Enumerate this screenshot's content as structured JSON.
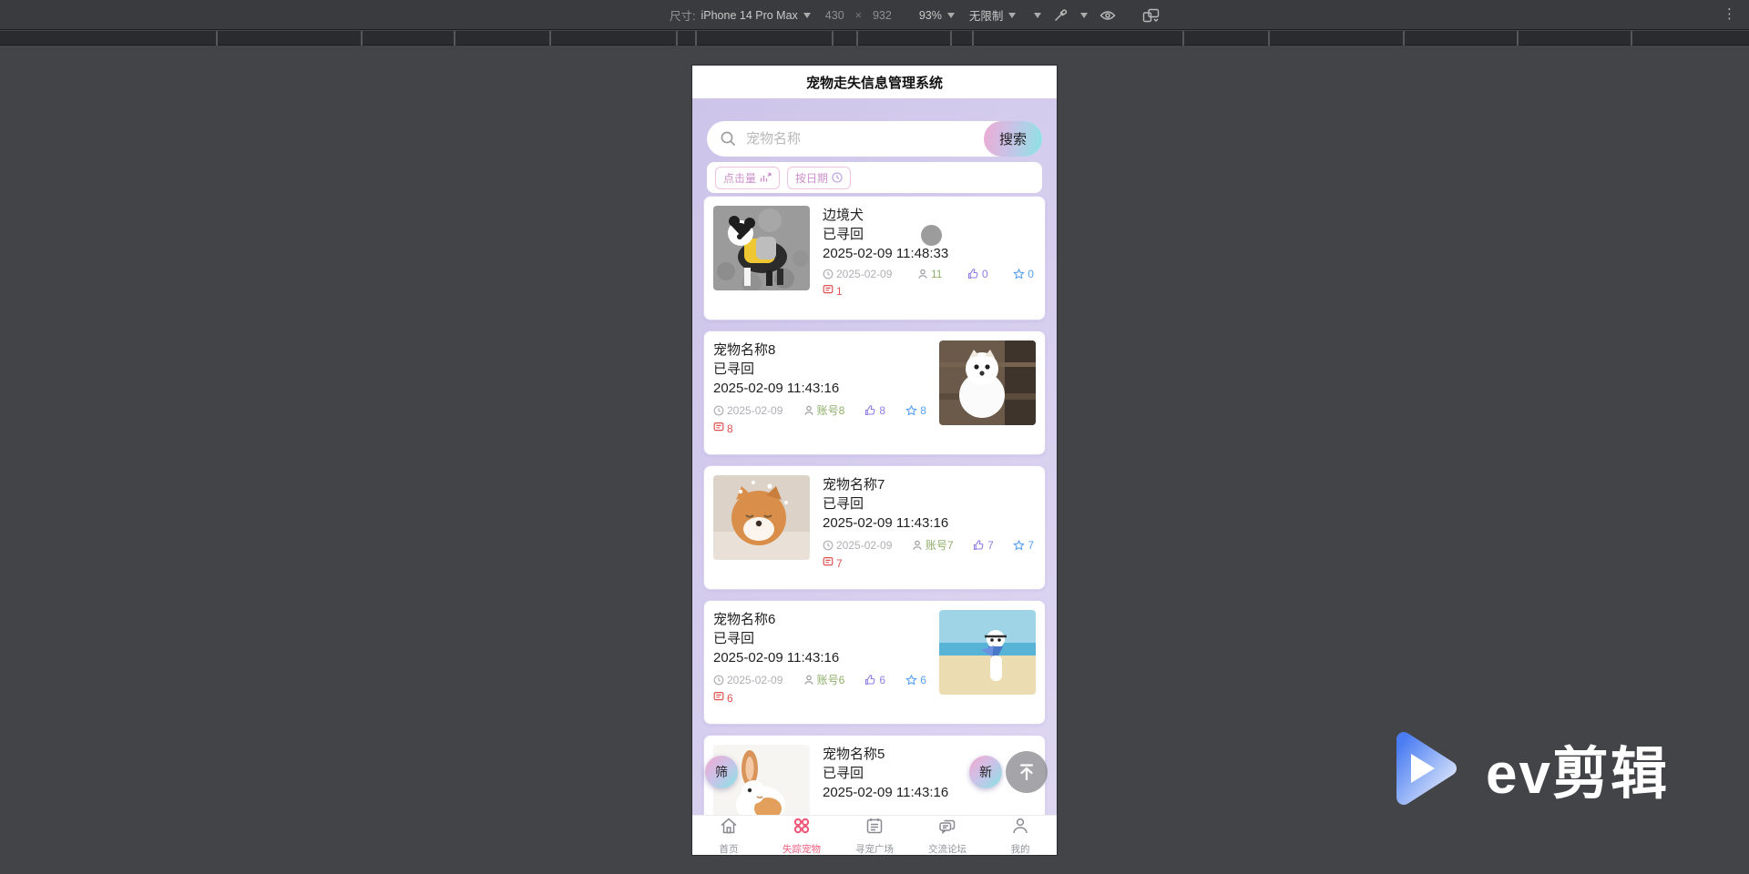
{
  "devtools": {
    "size_label": "尺寸:",
    "device": "iPhone 14 Pro Max",
    "viewport_width": "430",
    "multiply_sign": "×",
    "viewport_height": "932",
    "zoom": "93%",
    "throttling": "无限制",
    "menu_glyph": "⋮"
  },
  "app": {
    "title": "宠物走失信息管理系统",
    "search": {
      "placeholder": "宠物名称",
      "button_label": "搜索"
    },
    "filters": [
      {
        "label": "点击量",
        "icon": "bar-chart-icon"
      },
      {
        "label": "按日期",
        "icon": "clock-icon"
      }
    ],
    "cards": [
      {
        "name": "边境犬",
        "status": "已寻回",
        "datetime": "2025-02-09 11:48:33",
        "image_side": "left",
        "image_alt": "border-collie-dog-photo",
        "has_dot": true,
        "meta": {
          "date": "2025-02-09",
          "user": "11",
          "likes": "0",
          "stars": "0",
          "comments": "1"
        }
      },
      {
        "name": "宠物名称8",
        "status": "已寻回",
        "datetime": "2025-02-09 11:43:16",
        "image_side": "right",
        "image_alt": "white-pomeranian-photo",
        "has_dot": false,
        "meta": {
          "date": "2025-02-09",
          "user": "账号8",
          "likes": "8",
          "stars": "8",
          "comments": "8"
        }
      },
      {
        "name": "宠物名称7",
        "status": "已寻回",
        "datetime": "2025-02-09 11:43:16",
        "image_side": "left",
        "image_alt": "shiba-inu-photo",
        "has_dot": false,
        "meta": {
          "date": "2025-02-09",
          "user": "账号7",
          "likes": "7",
          "stars": "7",
          "comments": "7"
        }
      },
      {
        "name": "宠物名称6",
        "status": "已寻回",
        "datetime": "2025-02-09 11:43:16",
        "image_side": "right",
        "image_alt": "beach-dog-photo",
        "has_dot": false,
        "meta": {
          "date": "2025-02-09",
          "user": "账号6",
          "likes": "6",
          "stars": "6",
          "comments": "6"
        }
      },
      {
        "name": "宠物名称5",
        "status": "已寻回",
        "datetime": "2025-02-09 11:43:16",
        "image_side": "left",
        "image_alt": "rabbit-photo",
        "has_dot": false,
        "meta": null
      }
    ],
    "fabs": {
      "filter_label": "筛",
      "new_label": "新"
    },
    "nav": [
      {
        "label": "首页",
        "icon": "home-icon",
        "active": false
      },
      {
        "label": "失踪宠物",
        "icon": "pets-grid-icon",
        "active": true
      },
      {
        "label": "寻宠广场",
        "icon": "board-icon",
        "active": false
      },
      {
        "label": "交流论坛",
        "icon": "forum-icon",
        "active": false
      },
      {
        "label": "我的",
        "icon": "profile-icon",
        "active": false
      }
    ]
  },
  "watermark": {
    "brand": "ev剪辑"
  },
  "colors": {
    "accent_pink": "#edabd4",
    "accent_cyan": "#8be4e4",
    "nav_active": "#ee5d7e",
    "like_purple": "#8f7fe8",
    "star_blue": "#57a0f2",
    "comment_red": "#e05252",
    "user_green": "#8fae6b",
    "lavender_bg": "#cdc5e9"
  }
}
